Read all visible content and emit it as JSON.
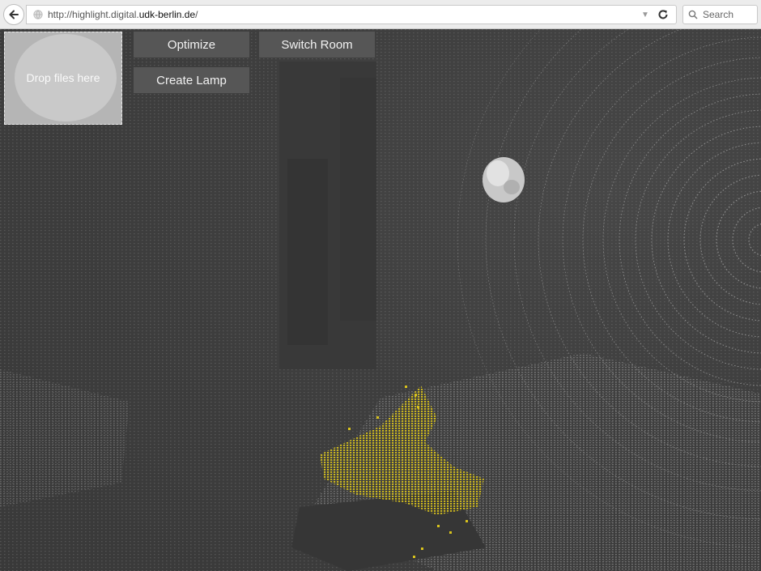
{
  "browser": {
    "url_prefix": "http://highlight.digital.",
    "url_domain": "udk-berlin.de",
    "url_suffix": "/",
    "search_placeholder": "Search"
  },
  "toolbar": {
    "dropzone_label": "Drop files here",
    "optimize_label": "Optimize",
    "switch_room_label": "Switch Room",
    "create_lamp_label": "Create Lamp"
  },
  "scene": {
    "highlight_color": "#d8c21c",
    "point_color": "#9a9a9a"
  }
}
